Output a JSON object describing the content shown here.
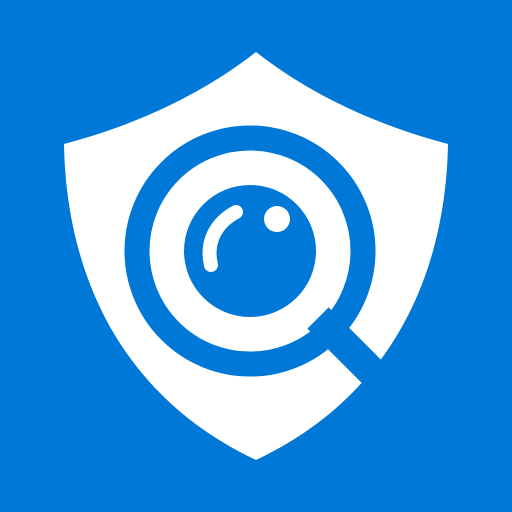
{
  "icon": {
    "name": "shield-search-icon",
    "colors": {
      "background": "#0078d7",
      "shield": "#ffffff",
      "magnifier": "#0078d7",
      "highlight": "#ffffff"
    }
  }
}
